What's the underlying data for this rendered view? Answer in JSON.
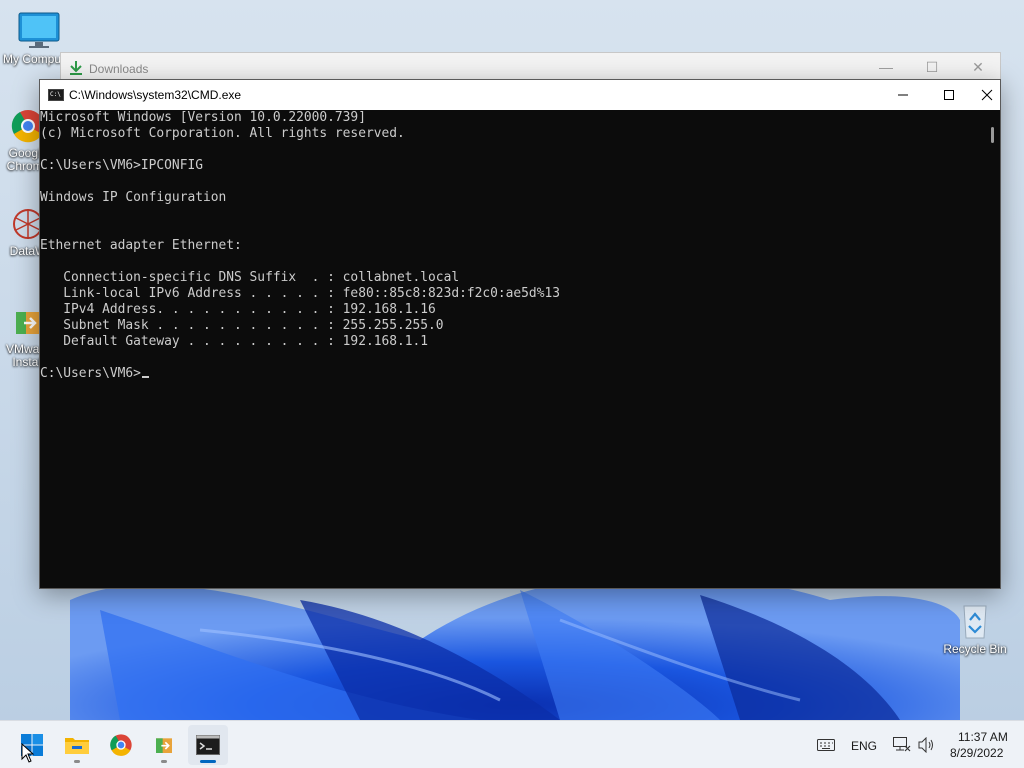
{
  "desktop": {
    "icons": [
      {
        "label": "My Computer"
      },
      {
        "label": "Google Chrome"
      },
      {
        "label": "DataW"
      },
      {
        "label": "VMware Install"
      },
      {
        "label": "Recycle Bin"
      }
    ]
  },
  "downloads_window": {
    "title": "Downloads"
  },
  "cmd_window": {
    "title": "C:\\Windows\\system32\\CMD.exe",
    "lines": [
      "Microsoft Windows [Version 10.0.22000.739]",
      "(c) Microsoft Corporation. All rights reserved.",
      "",
      "C:\\Users\\VM6>IPCONFIG",
      "",
      "Windows IP Configuration",
      "",
      "",
      "Ethernet adapter Ethernet:",
      "",
      "   Connection-specific DNS Suffix  . : collabnet.local",
      "   Link-local IPv6 Address . . . . . : fe80::85c8:823d:f2c0:ae5d%13",
      "   IPv4 Address. . . . . . . . . . . : 192.168.1.16",
      "   Subnet Mask . . . . . . . . . . . : 255.255.255.0",
      "   Default Gateway . . . . . . . . . : 192.168.1.1",
      ""
    ],
    "prompt": "C:\\Users\\VM6>"
  },
  "taskbar": {
    "apps": [
      {
        "name": "start",
        "icon": "windows-start-icon"
      },
      {
        "name": "file-explorer",
        "icon": "folder-icon"
      },
      {
        "name": "chrome",
        "icon": "chrome-icon"
      },
      {
        "name": "installer",
        "icon": "installer-icon"
      },
      {
        "name": "cmd",
        "icon": "terminal-icon"
      }
    ],
    "tray": {
      "language": "ENG",
      "time": "11:37 AM",
      "date": "8/29/2022"
    }
  },
  "colors": {
    "console_bg": "#0c0c0c",
    "console_fg": "#cccccc",
    "accent": "#0067c0"
  }
}
